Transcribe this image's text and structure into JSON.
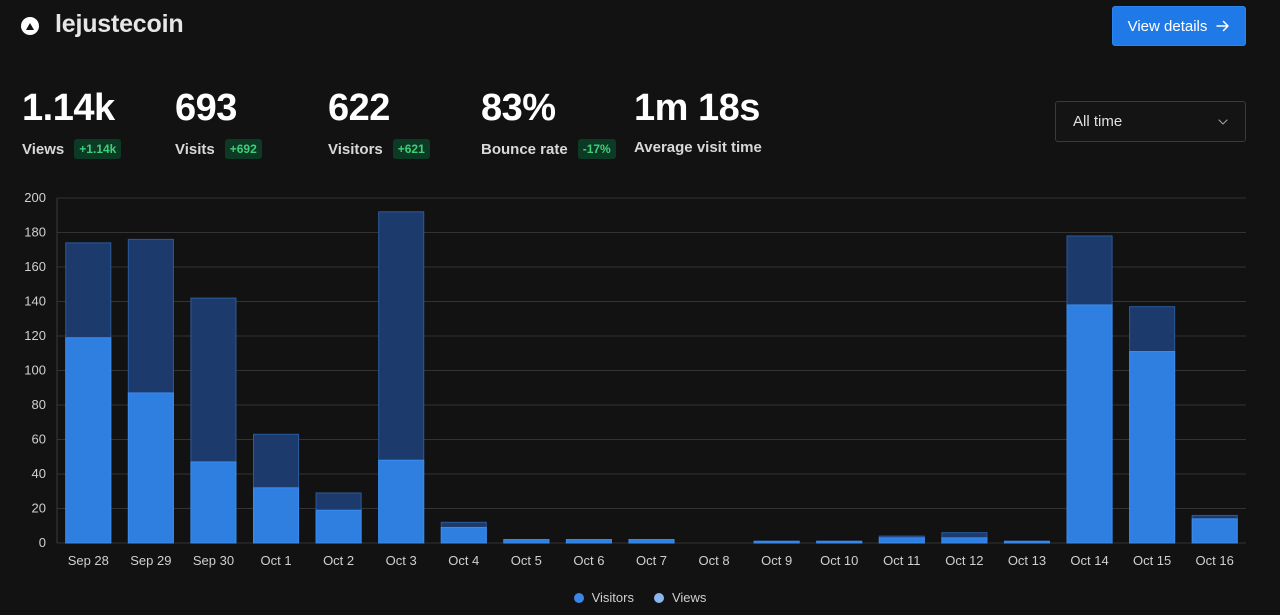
{
  "header": {
    "site_name": "lejustecoin",
    "view_details_label": "View details"
  },
  "metrics": [
    {
      "value": "1.14k",
      "label": "Views",
      "badge": "+1.14k"
    },
    {
      "value": "693",
      "label": "Visits",
      "badge": "+692"
    },
    {
      "value": "622",
      "label": "Visitors",
      "badge": "+621"
    },
    {
      "value": "83%",
      "label": "Bounce rate",
      "badge": "-17%"
    },
    {
      "value": "1m 18s",
      "label": "Average visit time",
      "badge": ""
    }
  ],
  "filter": {
    "selected": "All time"
  },
  "colors": {
    "visitors": "#2f7fe0",
    "views": "#1c3a6b",
    "badge_bg": "#0d3a24",
    "badge_text": "#3fcf7a",
    "accent": "#1f7ae8"
  },
  "chart_data": {
    "type": "bar",
    "stacked": "overlay",
    "categories": [
      "Sep 28",
      "Sep 29",
      "Sep 30",
      "Oct 1",
      "Oct 2",
      "Oct 3",
      "Oct 4",
      "Oct 5",
      "Oct 6",
      "Oct 7",
      "Oct 8",
      "Oct 9",
      "Oct 10",
      "Oct 11",
      "Oct 12",
      "Oct 13",
      "Oct 14",
      "Oct 15",
      "Oct 16"
    ],
    "series": [
      {
        "name": "Visitors",
        "values": [
          119,
          87,
          47,
          32,
          19,
          48,
          9,
          2,
          2,
          2,
          0,
          1,
          1,
          3,
          3,
          1,
          138,
          111,
          14
        ]
      },
      {
        "name": "Views",
        "values": [
          174,
          176,
          142,
          63,
          29,
          192,
          12,
          2,
          2,
          2,
          0,
          1,
          1,
          4,
          6,
          1,
          178,
          137,
          16
        ]
      }
    ],
    "ylim": [
      0,
      200
    ],
    "yticks": [
      0,
      20,
      40,
      60,
      80,
      100,
      120,
      140,
      160,
      180,
      200
    ],
    "grid": true,
    "legend_position": "bottom"
  }
}
